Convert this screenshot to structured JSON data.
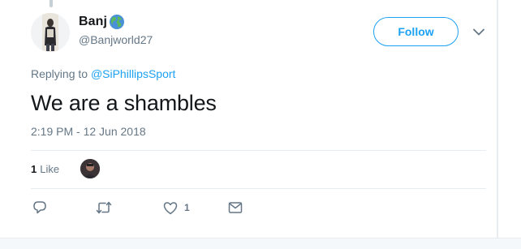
{
  "author": {
    "display_name": "Banj",
    "handle": "@Banjworld27"
  },
  "follow_button": {
    "label": "Follow"
  },
  "reply_context": {
    "prefix": "Replying to",
    "mention": "@SiPhillipsSport"
  },
  "tweet": {
    "text": "We are a shambles",
    "timestamp": "2:19 PM - 12 Jun 2018"
  },
  "engagement": {
    "like_count": "1",
    "like_label": "Like"
  },
  "actions": {
    "like_count": "1"
  },
  "colors": {
    "accent": "#1da1f2",
    "secondary_text": "#657786"
  },
  "icons": [
    "globe-emoji-icon",
    "chevron-down-icon",
    "reply-icon",
    "retweet-icon",
    "heart-icon",
    "envelope-icon"
  ]
}
